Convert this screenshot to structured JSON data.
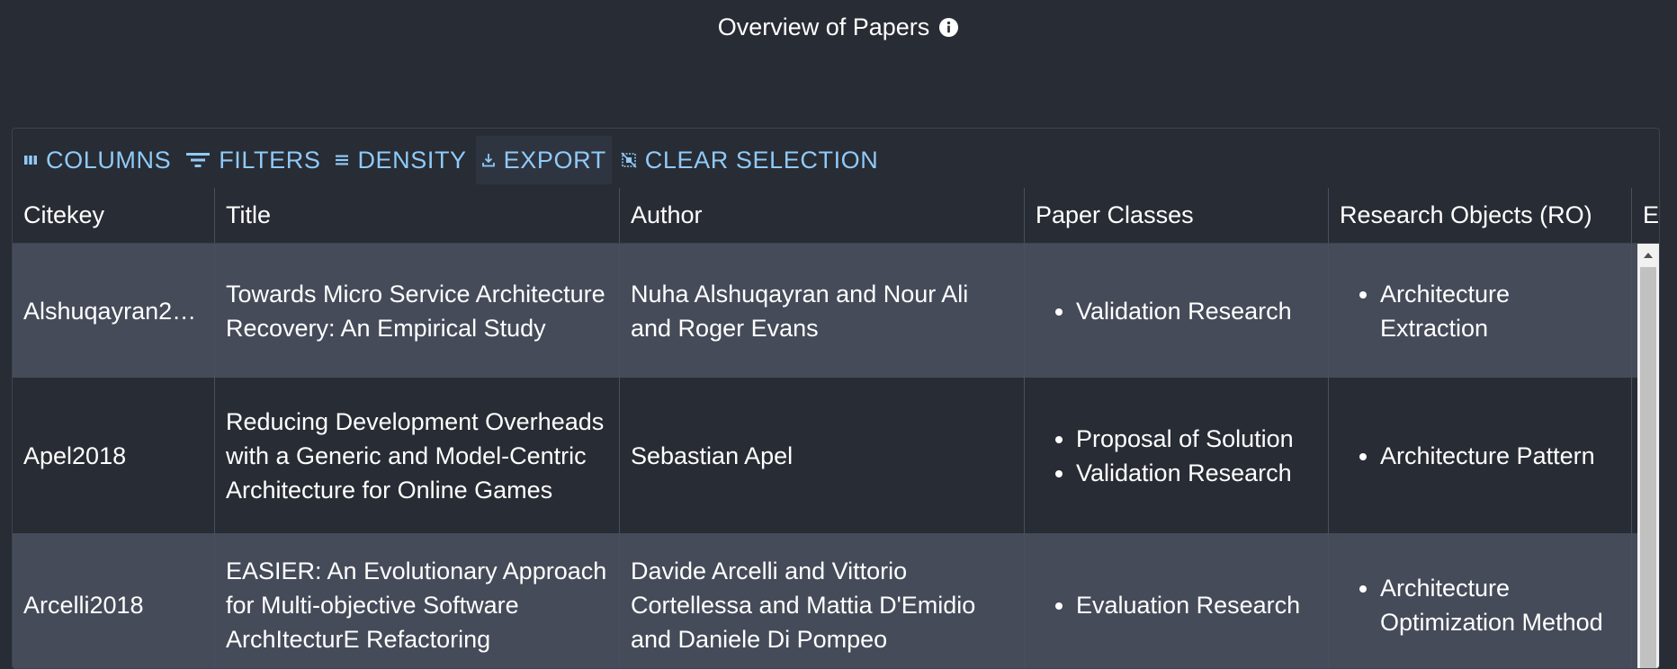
{
  "page": {
    "title": "Overview of Papers",
    "info_icon": "info-icon"
  },
  "toolbar": {
    "columns_label": "COLUMNS",
    "filters_label": "FILTERS",
    "density_label": "DENSITY",
    "export_label": "EXPORT",
    "clear_selection_label": "CLEAR SELECTION",
    "accent_color": "#90caf9"
  },
  "table": {
    "headers": {
      "citekey": "Citekey",
      "title": "Title",
      "author": "Author",
      "paper_classes": "Paper Classes",
      "research_objects": "Research Objects (RO)",
      "next": "E"
    },
    "rows": [
      {
        "citekey": "Alshuqayran2…",
        "title": "Towards Micro Service Architecture Recovery: An Empirical Study",
        "author": "Nuha Alshuqayran and Nour Ali and Roger Evans",
        "paper_classes": [
          "Validation Research"
        ],
        "research_objects": [
          "Architecture Extraction"
        ]
      },
      {
        "citekey": "Apel2018",
        "title": "Reducing Development Overheads with a Generic and Model-Centric Architecture for Online Games",
        "author": "Sebastian Apel",
        "paper_classes": [
          "Proposal of Solution",
          "Validation Research"
        ],
        "research_objects": [
          "Architecture Pattern"
        ]
      },
      {
        "citekey": "Arcelli2018",
        "title": "EASIER: An Evolutionary Approach for Multi-objective Software ArchItecturE Refactoring",
        "author": "Davide Arcelli and Vittorio Cortellessa and Mattia D'Emidio and Daniele Di Pompeo",
        "paper_classes": [
          "Evaluation Research"
        ],
        "research_objects": [
          "Architecture Optimization Method"
        ]
      }
    ]
  }
}
